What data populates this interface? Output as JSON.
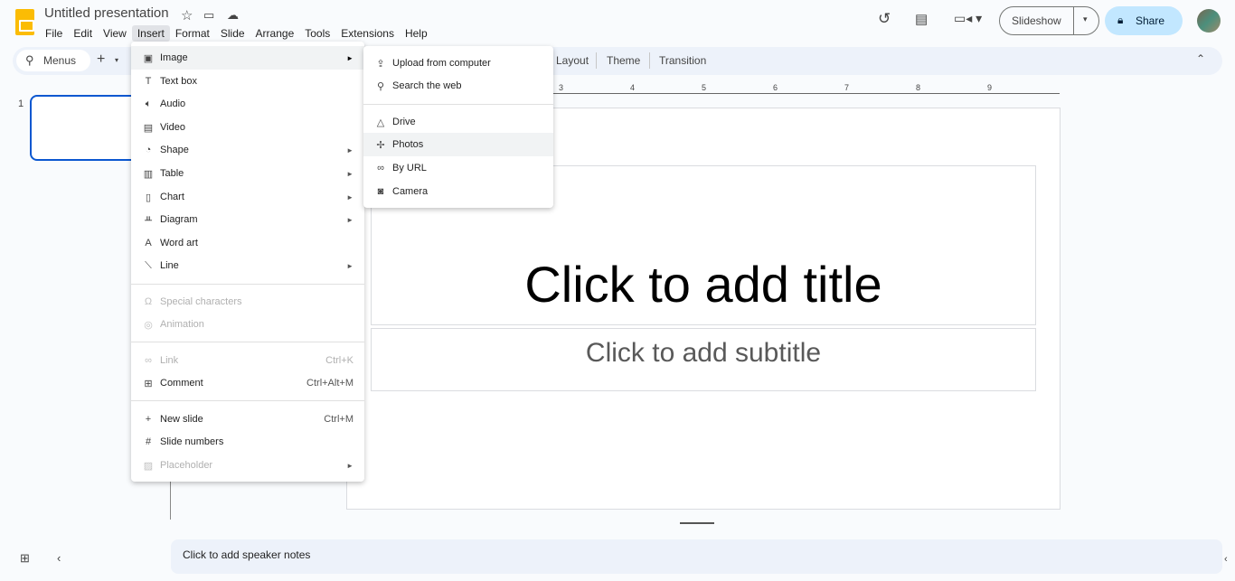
{
  "app": {
    "title": "Untitled presentation",
    "accent": "#0b57d0",
    "logo_color": "#fbbc04"
  },
  "menubar": [
    "File",
    "Edit",
    "View",
    "Insert",
    "Format",
    "Slide",
    "Arrange",
    "Tools",
    "Extensions",
    "Help"
  ],
  "toolbar": {
    "search": "Menus",
    "layout": "Layout",
    "theme": "Theme",
    "transition": "Transition"
  },
  "header": {
    "slideshow": "Slideshow",
    "share": "Share"
  },
  "ruler": [
    "3",
    "4",
    "5",
    "6",
    "7",
    "8",
    "9"
  ],
  "filmstrip": {
    "slide_number": "1"
  },
  "slide": {
    "title": "Click to add title",
    "subtitle": "Click to add subtitle"
  },
  "notes": "Click to add speaker notes",
  "insert_menu": [
    {
      "label": "Image",
      "icon": "image-icon",
      "arrow": true
    },
    {
      "label": "Text box",
      "icon": "text-box-icon"
    },
    {
      "label": "Audio",
      "icon": "audio-icon"
    },
    {
      "label": "Video",
      "icon": "video-icon"
    },
    {
      "label": "Shape",
      "icon": "shape-icon",
      "arrow": true
    },
    {
      "label": "Table",
      "icon": "table-icon",
      "arrow": true
    },
    {
      "label": "Chart",
      "icon": "chart-icon",
      "arrow": true
    },
    {
      "label": "Diagram",
      "icon": "diagram-icon",
      "arrow": true
    },
    {
      "label": "Word art",
      "icon": "word-art-icon"
    },
    {
      "label": "Line",
      "icon": "line-icon",
      "arrow": true
    },
    {
      "label": "Special characters",
      "icon": "omega-icon",
      "disabled": true
    },
    {
      "label": "Animation",
      "icon": "animation-icon",
      "disabled": true
    },
    {
      "label": "Link",
      "icon": "link-icon",
      "shortcut": "Ctrl+K",
      "disabled": true
    },
    {
      "label": "Comment",
      "icon": "comment-icon",
      "shortcut": "Ctrl+Alt+M"
    },
    {
      "label": "New slide",
      "icon": "plus-icon",
      "shortcut": "Ctrl+M"
    },
    {
      "label": "Slide numbers",
      "icon": "hash-icon"
    },
    {
      "label": "Placeholder",
      "icon": "placeholder-icon",
      "arrow": true,
      "disabled": true
    }
  ],
  "image_submenu": [
    {
      "label": "Upload from computer",
      "icon": "upload-icon"
    },
    {
      "label": "Search the web",
      "icon": "search-icon"
    },
    {
      "label": "Drive",
      "icon": "drive-icon"
    },
    {
      "label": "Photos",
      "icon": "photos-icon",
      "highlighted": true
    },
    {
      "label": "By URL",
      "icon": "link-icon"
    },
    {
      "label": "Camera",
      "icon": "camera-icon"
    }
  ]
}
